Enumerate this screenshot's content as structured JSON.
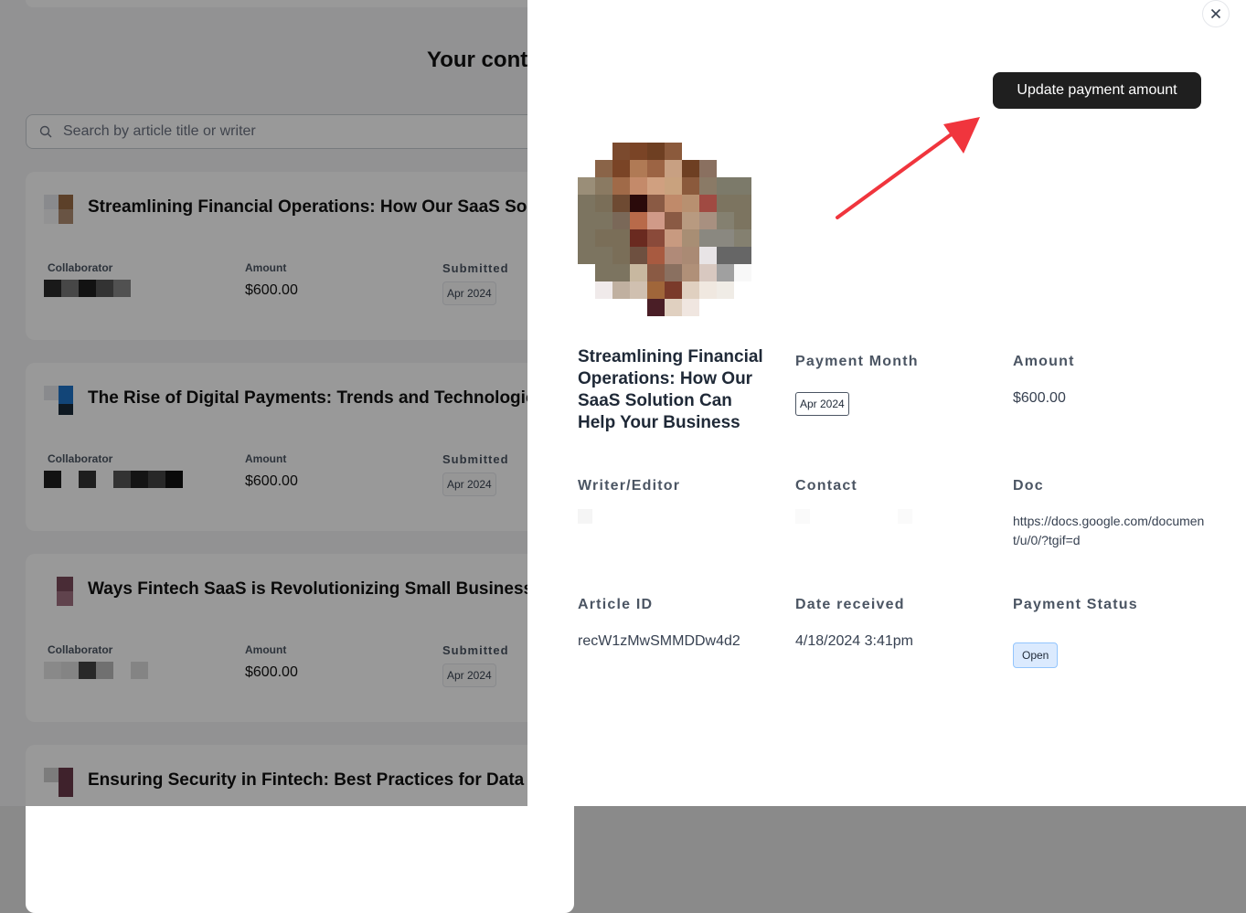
{
  "background": {
    "page_title": "Your conte",
    "search": {
      "placeholder": "Search by article title or writer"
    },
    "labels": {
      "collaborator": "Collaborator",
      "amount": "Amount",
      "submitted": "Submitted"
    },
    "cards": [
      {
        "title": "Streamlining Financial Operations: How Our SaaS So",
        "amount": "$600.00",
        "submitted": "Apr 2024"
      },
      {
        "title": "The Rise of Digital Payments: Trends and Technologie",
        "amount": "$600.00",
        "submitted": "Apr 2024"
      },
      {
        "title": "Ways Fintech SaaS is Revolutionizing Small Business",
        "amount": "$600.00",
        "submitted": "Apr 2024"
      },
      {
        "title": "Ensuring Security in Fintech: Best Practices for Data P",
        "amount": "",
        "submitted": ""
      }
    ]
  },
  "drawer": {
    "update_button_label": "Update payment amount",
    "article_title": "Streamlining Financial Operations: How Our SaaS Solution Can Help Your Business",
    "fields": {
      "payment_month_label": "Payment Month",
      "payment_month_value": "Apr 2024",
      "amount_label": "Amount",
      "amount_value": "$600.00",
      "writer_label": "Writer/Editor",
      "contact_label": "Contact",
      "doc_label": "Doc",
      "doc_value": "https://docs.google.com/document/u/0/?tgif=d",
      "article_id_label": "Article ID",
      "article_id_value": "recW1zMwSMMDDw4d2",
      "date_received_label": "Date received",
      "date_received_value": "4/18/2024 3:41pm",
      "payment_status_label": "Payment Status",
      "payment_status_value": "Open"
    }
  },
  "colors": {
    "overlay": "#000000",
    "button_dark": "#1f1f1f",
    "arrow_red": "#f0353d",
    "status_badge_bg": "#dbeafe",
    "status_badge_border": "#93c5fd"
  }
}
